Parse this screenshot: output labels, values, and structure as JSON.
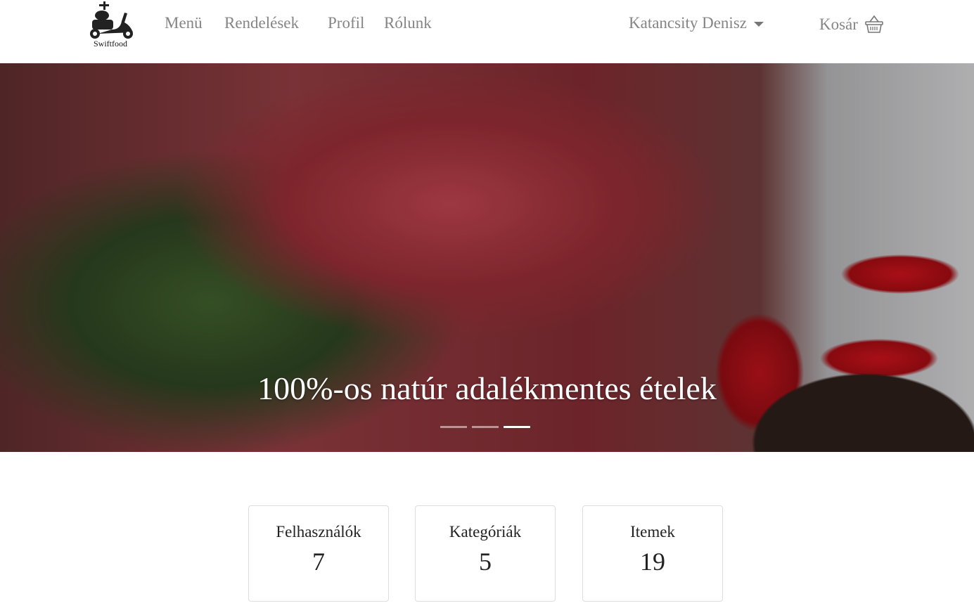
{
  "brand": {
    "name": "Swiftfood"
  },
  "nav": {
    "items": [
      "Menü",
      "Rendelések",
      "Profil",
      "Rólunk"
    ],
    "user": "Katancsity Denisz",
    "cart": "Kosár"
  },
  "hero": {
    "caption": "100%-os natúr adalékmentes ételek",
    "slides": 3,
    "active_slide": 3
  },
  "stats": [
    {
      "label": "Felhasználók",
      "value": "7"
    },
    {
      "label": "Kategóriák",
      "value": "5"
    },
    {
      "label": "Itemek",
      "value": "19"
    }
  ]
}
